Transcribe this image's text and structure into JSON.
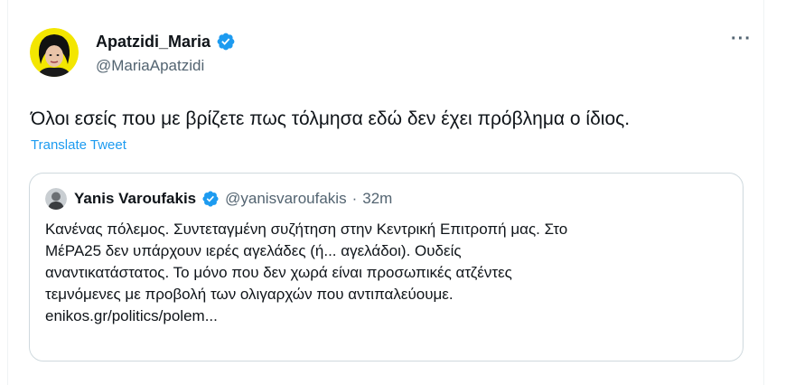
{
  "tweet": {
    "author": {
      "display_name": "Apatzidi_Maria",
      "handle": "@MariaApatzidi",
      "verified": true
    },
    "more_label": "···",
    "text": "Όλοι εσείς που με βρίζετε πως τόλμησα εδώ δεν έχει πρόβλημα ο ίδιος.",
    "translate_label": "Translate Tweet"
  },
  "quote": {
    "author": {
      "display_name": "Yanis Varoufakis",
      "handle": "@yanisvaroufakis",
      "verified": true
    },
    "separator": "·",
    "time": "32m",
    "lines": [
      "Κανένας πόλεμος. Συντεταγμένη συζήτηση στην Κεντρική Επιτροπή μας. Στο",
      "ΜέΡΑ25 δεν υπάρχουν ιερές αγελάδες (ή... αγελάδοι). Ουδείς",
      "αναντικατάστατος. Το μόνο που δεν χωρά είναι προσωπικές ατζέντες",
      "τεμνόμενες με προβολή των ολιγαρχών που αντιπαλεύουμε."
    ],
    "link": "enikos.gr/politics/polem..."
  },
  "colors": {
    "accent": "#1d9bf0",
    "text_primary": "#0f1419",
    "text_secondary": "#536471",
    "border": "#cfd9de"
  },
  "icons": {
    "verified": "verified-badge-icon",
    "more": "more-options-icon"
  }
}
